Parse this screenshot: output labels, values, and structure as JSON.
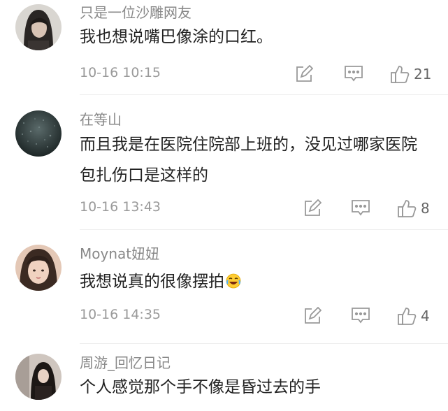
{
  "comments": [
    {
      "username": "只是一位沙雕网友",
      "text": "我也想说嘴巴像涂的口红。",
      "time": "10-16 10:15",
      "likes": "21"
    },
    {
      "username": "在等山",
      "text": "而且我是在医院住院部上班的，没见过哪家医院包扎伤口是这样的",
      "time": "10-16 13:43",
      "likes": "8"
    },
    {
      "username": "Moynat妞妞",
      "text": "我想说真的很像摆拍",
      "time": "10-16 14:35",
      "likes": "4"
    },
    {
      "username": "周游_回忆日记",
      "text": "个人感觉那个手不像是昏过去的手"
    }
  ],
  "icons": {
    "reply": "edit-square-icon",
    "comment": "comment-bubble-icon",
    "like": "thumbs-up-icon",
    "laugh": "laughing-tears-emoji"
  },
  "colors": {
    "username": "#888888",
    "text": "#222222",
    "meta": "#9a9a9a",
    "icon": "#999999"
  }
}
